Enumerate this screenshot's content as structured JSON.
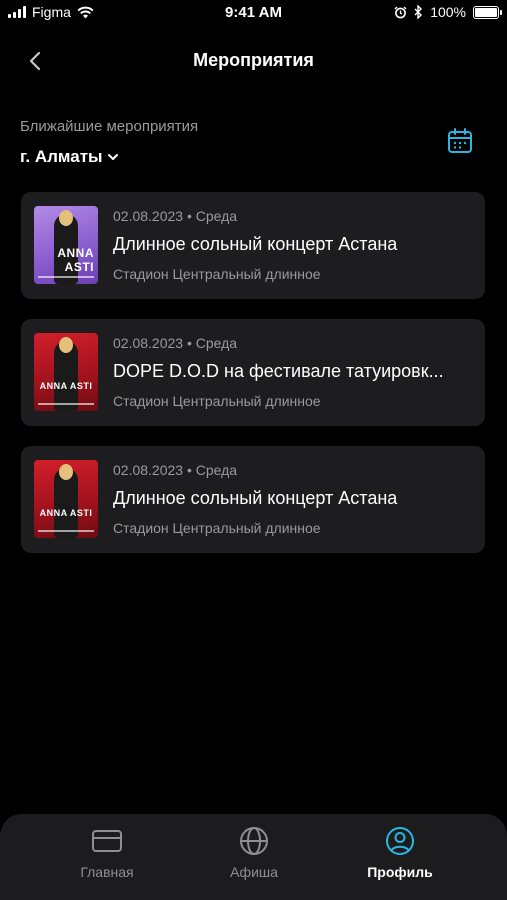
{
  "status_bar": {
    "carrier": "Figma",
    "time": "9:41 AM",
    "battery": "100%",
    "icons": [
      "signal-icon",
      "wifi-icon",
      "alarm-icon",
      "bluetooth-icon",
      "battery-icon"
    ]
  },
  "nav": {
    "title": "Мероприятия",
    "back_icon": "chevron-left-icon"
  },
  "section": {
    "label": "Ближайшие мероприятия",
    "city": "г. Алматы",
    "calendar_icon": "calendar-icon"
  },
  "colors": {
    "accent": "#2bb5e0",
    "background": "#000000",
    "card": "#1d1d1f",
    "muted_text": "#9a9a9a"
  },
  "events": [
    {
      "date": "02.08.2023 • Среда",
      "title": "Длинное сольный концерт Астана",
      "venue": "Стадион Центральный длинное",
      "poster_text": "ANNA ASTI"
    },
    {
      "date": "02.08.2023 • Среда",
      "title": "DOPE D.O.D на фестивале татуировк...",
      "venue": "Стадион Центральный длинное",
      "poster_text": "ANNA ASTI"
    },
    {
      "date": "02.08.2023 • Среда",
      "title": "Длинное сольный концерт Астана",
      "venue": "Стадион Центральный длинное",
      "poster_text": "ANNA ASTI"
    }
  ],
  "tabbar": {
    "tabs": [
      {
        "label": "Главная",
        "icon": "card-icon",
        "active": false
      },
      {
        "label": "Афиша",
        "icon": "globe-icon",
        "active": false
      },
      {
        "label": "Профиль",
        "icon": "user-circle-icon",
        "active": true
      }
    ]
  }
}
